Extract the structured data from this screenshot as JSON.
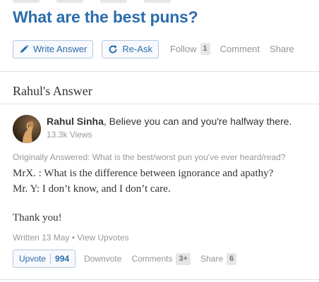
{
  "question": {
    "title": "What are the best puns?"
  },
  "actions": {
    "write_answer": "Write Answer",
    "re_ask": "Re-Ask",
    "follow": "Follow",
    "follow_count": "1",
    "comment": "Comment",
    "share": "Share"
  },
  "answer": {
    "heading": "Rahul's Answer",
    "author_name": "Rahul Sinha",
    "author_tagline": ", Believe you can and you're halfway there.",
    "views": "13.3k Views",
    "originally_answered": "Originally Answered: What is the best/worst pun you've ever heard/read?",
    "body_lines": [
      "MrX. : What is the difference between ignorance and apathy?",
      "Mr. Y: I don’t know, and I don’t care.",
      "Thank you!"
    ],
    "written": "Written 13 May",
    "meta_sep": " • ",
    "view_upvotes": "View Upvotes"
  },
  "footer": {
    "upvote": "Upvote",
    "upvote_count": "994",
    "downvote": "Downvote",
    "comments": "Comments",
    "comments_count": "3+",
    "share": "Share",
    "share_count": "6"
  },
  "colors": {
    "link_blue": "#2b6dad",
    "muted_gray": "#949494",
    "border_blue": "#b5c7de"
  },
  "icons": {
    "write": "pencil-icon",
    "reask": "refresh-icon"
  }
}
